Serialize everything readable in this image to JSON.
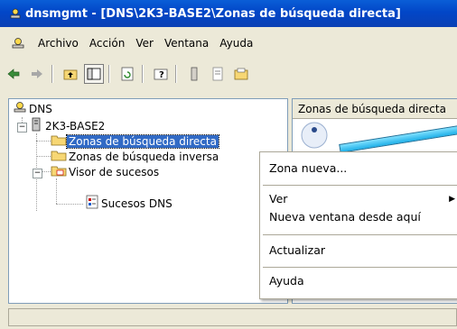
{
  "window": {
    "title": "dnsmgmt - [DNS\\2K3-BASE2\\Zonas de búsqueda directa]"
  },
  "menubar": {
    "items": [
      {
        "label": "Archivo"
      },
      {
        "label": "Acción"
      },
      {
        "label": "Ver"
      },
      {
        "label": "Ventana"
      },
      {
        "label": "Ayuda"
      }
    ]
  },
  "tree": {
    "root": "DNS",
    "server": "2K3-BASE2",
    "forward": "Zonas de búsqueda directa",
    "reverse": "Zonas de búsqueda inversa",
    "events": "Visor de sucesos",
    "dns_events": "Sucesos DNS"
  },
  "right_pane": {
    "column_header": "Zonas de búsqueda directa"
  },
  "context_menu": {
    "items": [
      {
        "label": "Zona nueva..."
      },
      {
        "label": "Ver"
      },
      {
        "label": "Nueva ventana desde aquí"
      },
      {
        "label": "Actualizar"
      },
      {
        "label": "Ayuda"
      }
    ]
  },
  "colors": {
    "titlebar": "#0a46c4",
    "selection": "#316ac5",
    "annotation_arrow": "#1fb0e8"
  }
}
